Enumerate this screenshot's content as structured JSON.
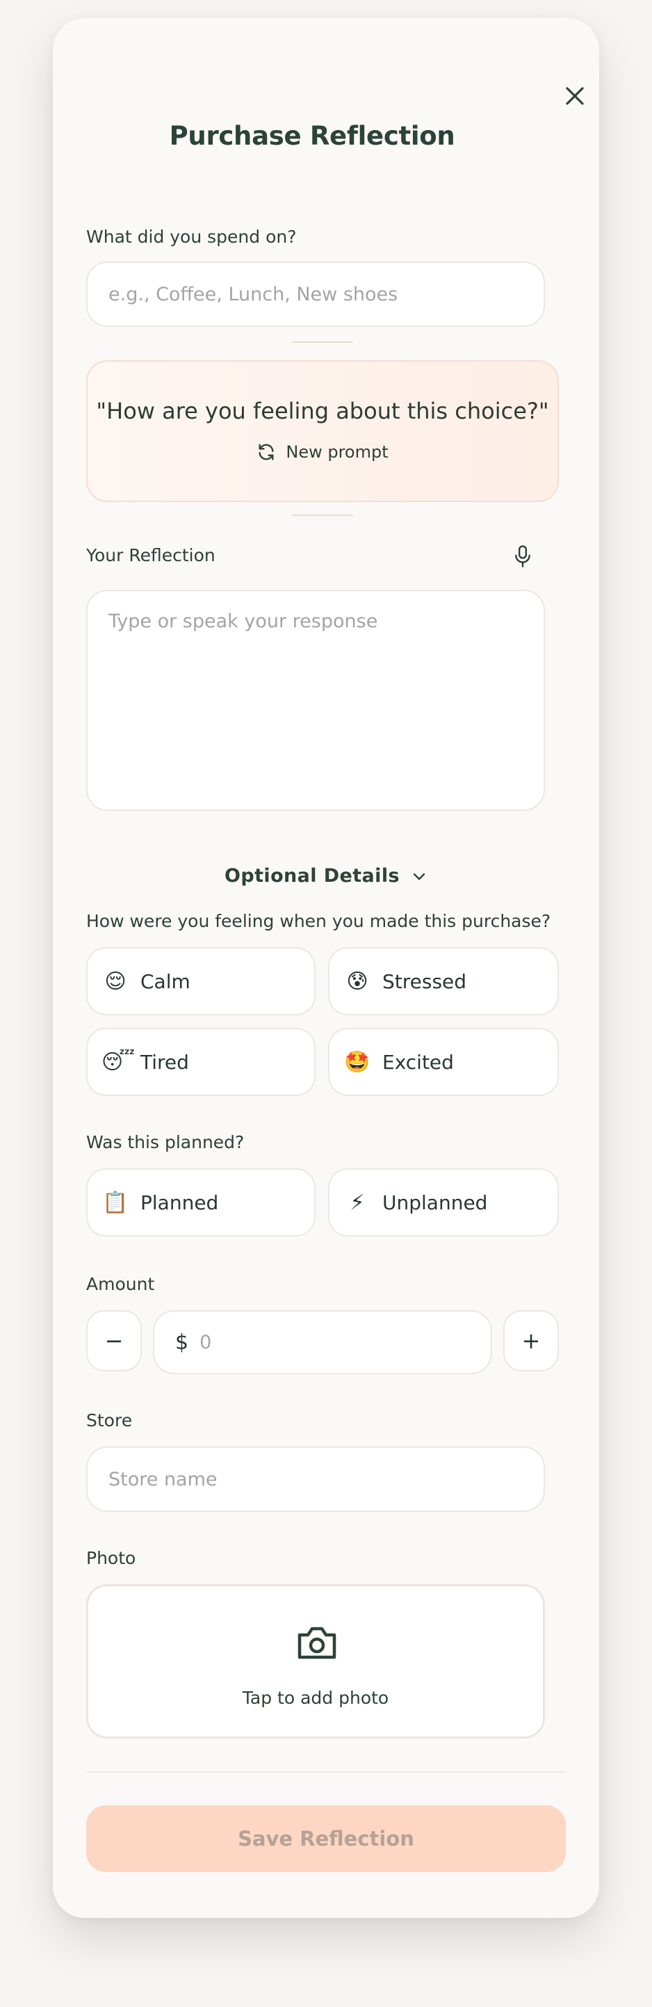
{
  "header": {
    "title": "Purchase Reflection"
  },
  "spend": {
    "label": "What did you spend on?",
    "placeholder": "e.g., Coffee, Lunch, New shoes"
  },
  "prompt": {
    "text": "\"How are you feeling about this choice?\"",
    "new_prompt_label": "New prompt"
  },
  "reflection": {
    "label": "Your Reflection",
    "placeholder": "Type or speak your response"
  },
  "optional": {
    "label": "Optional Details"
  },
  "feeling": {
    "question": "How were you feeling when you made this purchase?",
    "options": [
      {
        "emoji": "😌",
        "label": "Calm"
      },
      {
        "emoji": "😰",
        "label": "Stressed"
      },
      {
        "emoji": "😴",
        "label": "Tired"
      },
      {
        "emoji": "🤩",
        "label": "Excited"
      }
    ]
  },
  "planned": {
    "question": "Was this planned?",
    "options": [
      {
        "emoji": "📋",
        "label": "Planned"
      },
      {
        "emoji": "⚡",
        "label": "Unplanned"
      }
    ]
  },
  "amount": {
    "label": "Amount",
    "currency": "$",
    "placeholder": "0",
    "decrement": "−",
    "increment": "+"
  },
  "store": {
    "label": "Store",
    "placeholder": "Store name"
  },
  "photo": {
    "label": "Photo",
    "cta": "Tap to add photo"
  },
  "save": {
    "label": "Save Reflection"
  },
  "colors": {
    "accent": "#fdd7c4",
    "heading": "#2c4337",
    "prompt_bg": "#fdf1ea"
  }
}
